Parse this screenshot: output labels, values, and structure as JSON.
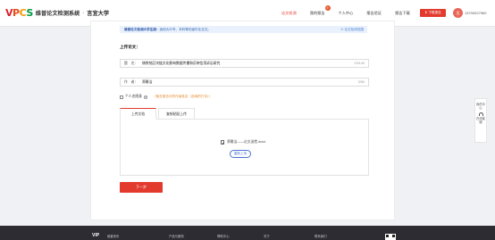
{
  "header": {
    "logo_mark": "VPCS",
    "logo_title": "维普论文检测系统",
    "logo_dot": "·",
    "school": "言宜大学",
    "nav": [
      {
        "label": "论文检测",
        "active": true
      },
      {
        "label": "我的报告",
        "badge": "9"
      },
      {
        "label": "个人中心"
      },
      {
        "label": "报告验证"
      },
      {
        "label": "报告下载"
      }
    ],
    "download_button": "下载报告",
    "user_avatar_initial": "言",
    "user_phone": "13700027960"
  },
  "notice": {
    "text_bold": "维普论文检测大学生版：",
    "text": "适用大中专、本科等初级毕业论文。",
    "link": "① 论文检测范围"
  },
  "section_title": "上传论文：",
  "fields": {
    "title_label": "题　名：",
    "title_value": "铸铁铭区块链文化影响数据传播和反映信用诉讼研究",
    "title_count": "23/140",
    "author_label": "作　者：",
    "author_value": "郑雅洁",
    "author_count": "3/50"
  },
  "anonymous": {
    "label": "个人名隐身",
    "help": "?",
    "hint": "（隐去报告中的作者姓名（选填的打勾））"
  },
  "tabs": {
    "upload_doc": "上传文档",
    "paste_text": "复制粘贴上传"
  },
  "upload": {
    "file_name": "郑雅洁——论文送检.docx",
    "reupload_button": "重新上传"
  },
  "next_button": "下一步",
  "side_float": {
    "item1": "我的中心",
    "item2": "在线客服"
  },
  "footer": {
    "logo": "VIP",
    "logo_sub": "维普资讯",
    "links": [
      "产品与服务",
      "帮助中心",
      "关于",
      "联系我们"
    ]
  },
  "colors": {
    "accent": "#e23b2e",
    "link_blue": "#4a74d1",
    "notice_bg": "#e8f1fc",
    "footer_bg": "#2c2c32"
  }
}
